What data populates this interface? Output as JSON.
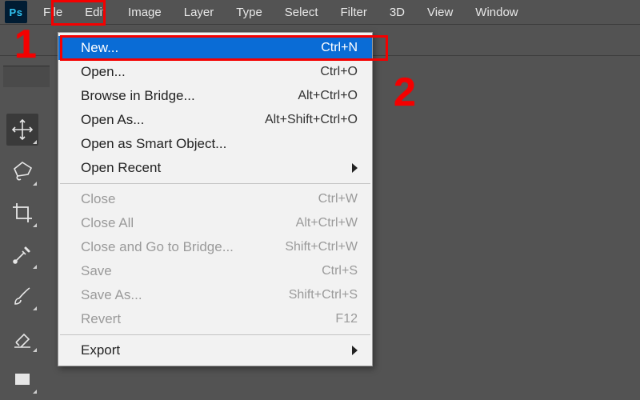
{
  "app": {
    "logo_text": "Ps"
  },
  "menubar": {
    "items": [
      "File",
      "Edit",
      "Image",
      "Layer",
      "Type",
      "Select",
      "Filter",
      "3D",
      "View",
      "Window"
    ]
  },
  "dropdown": {
    "groups": [
      [
        {
          "label": "New...",
          "shortcut": "Ctrl+N",
          "highlight": true
        },
        {
          "label": "Open...",
          "shortcut": "Ctrl+O"
        },
        {
          "label": "Browse in Bridge...",
          "shortcut": "Alt+Ctrl+O"
        },
        {
          "label": "Open As...",
          "shortcut": "Alt+Shift+Ctrl+O"
        },
        {
          "label": "Open as Smart Object..."
        },
        {
          "label": "Open Recent",
          "submenu": true
        }
      ],
      [
        {
          "label": "Close",
          "shortcut": "Ctrl+W",
          "disabled": true
        },
        {
          "label": "Close All",
          "shortcut": "Alt+Ctrl+W",
          "disabled": true
        },
        {
          "label": "Close and Go to Bridge...",
          "shortcut": "Shift+Ctrl+W",
          "disabled": true
        },
        {
          "label": "Save",
          "shortcut": "Ctrl+S",
          "disabled": true
        },
        {
          "label": "Save As...",
          "shortcut": "Shift+Ctrl+S",
          "disabled": true
        },
        {
          "label": "Revert",
          "shortcut": "F12",
          "disabled": true
        }
      ],
      [
        {
          "label": "Export",
          "submenu": true
        }
      ]
    ]
  },
  "annotations": {
    "num1": "1",
    "num2": "2"
  },
  "tools": [
    "move",
    "lasso",
    "crop",
    "eyedropper",
    "brush",
    "eraser",
    "rectangle"
  ]
}
